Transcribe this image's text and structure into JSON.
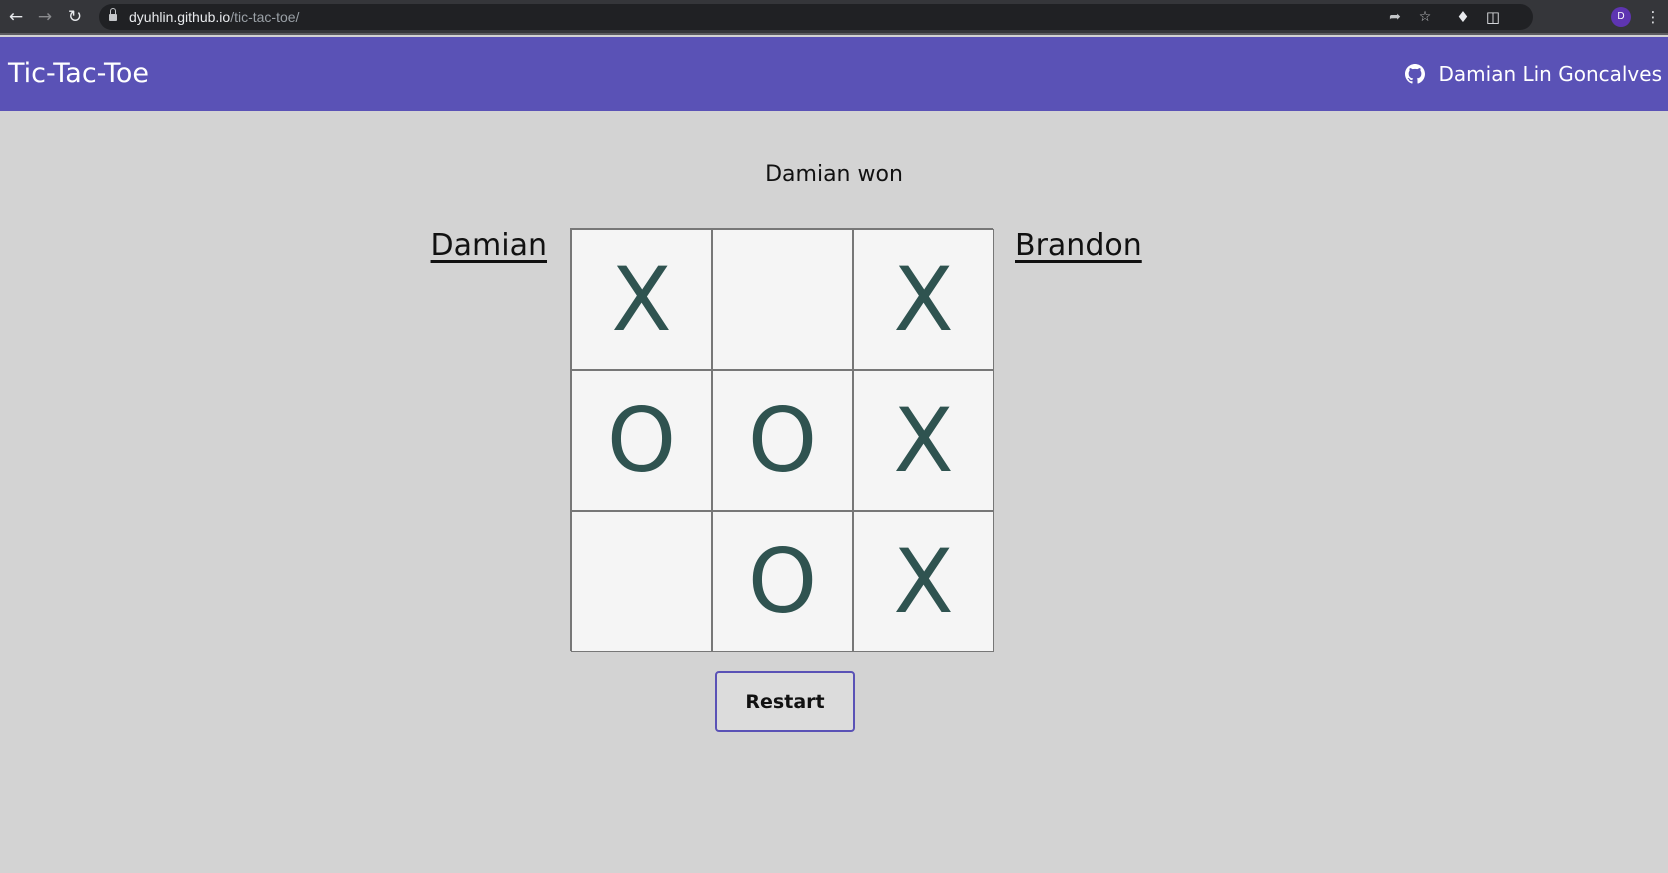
{
  "browser": {
    "url_host": "dyuhlin.github.io",
    "url_path": "/tic-tac-toe/",
    "profile_initial": "D"
  },
  "header": {
    "title": "Tic-Tac-Toe",
    "author": "Damian Lin Goncalves",
    "accent_color": "#5a52b6"
  },
  "game": {
    "status": "Damian won",
    "player1": "Damian",
    "player2": "Brandon",
    "board": [
      "X",
      "",
      "X",
      "O",
      "O",
      "X",
      "",
      "O",
      "X"
    ],
    "mark_color": "#2f5350",
    "restart_label": "Restart"
  }
}
